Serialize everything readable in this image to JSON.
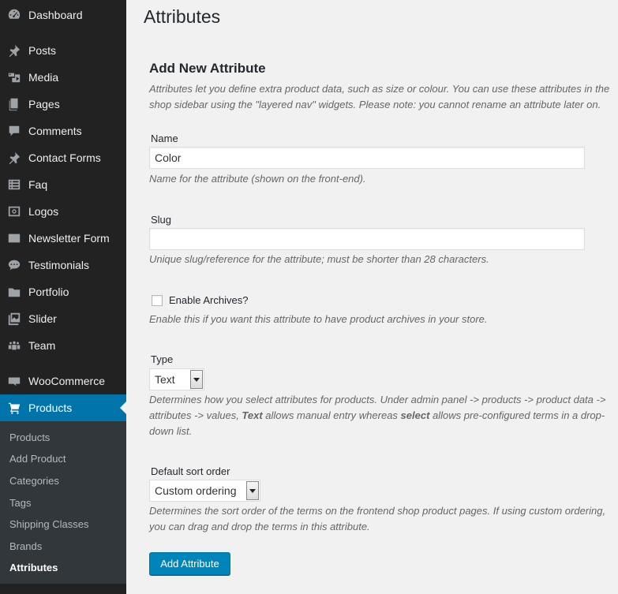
{
  "sidebar": {
    "items": [
      {
        "label": "Dashboard",
        "icon": "dashboard-icon"
      },
      {
        "label": "Posts",
        "icon": "pin-icon"
      },
      {
        "label": "Media",
        "icon": "media-icon"
      },
      {
        "label": "Pages",
        "icon": "pages-icon"
      },
      {
        "label": "Comments",
        "icon": "comment-icon"
      },
      {
        "label": "Contact Forms",
        "icon": "pin-icon"
      },
      {
        "label": "Faq",
        "icon": "list-icon"
      },
      {
        "label": "Logos",
        "icon": "camera-icon"
      },
      {
        "label": "Newsletter Form",
        "icon": "envelope-icon"
      },
      {
        "label": "Testimonials",
        "icon": "chat-icon"
      },
      {
        "label": "Portfolio",
        "icon": "folder-icon"
      },
      {
        "label": "Slider",
        "icon": "gallery-icon"
      },
      {
        "label": "Team",
        "icon": "groups-icon"
      },
      {
        "label": "WooCommerce",
        "icon": "woo-icon"
      },
      {
        "label": "Products",
        "icon": "cart-icon",
        "current": true
      }
    ],
    "submenu": [
      {
        "label": "Products"
      },
      {
        "label": "Add Product"
      },
      {
        "label": "Categories"
      },
      {
        "label": "Tags"
      },
      {
        "label": "Shipping Classes"
      },
      {
        "label": "Brands"
      },
      {
        "label": "Attributes",
        "active": true
      }
    ]
  },
  "page": {
    "title": "Attributes",
    "section_title": "Add New Attribute",
    "intro": "Attributes let you define extra product data, such as size or colour. You can use these attributes in the shop sidebar using the \"layered nav\" widgets. Please note: you cannot rename an attribute later on."
  },
  "form": {
    "name_label": "Name",
    "name_value": "Color",
    "name_desc": "Name for the attribute (shown on the front-end).",
    "slug_label": "Slug",
    "slug_value": "",
    "slug_desc": "Unique slug/reference for the attribute; must be shorter than 28 characters.",
    "archives_label": "Enable Archives?",
    "archives_checked": false,
    "archives_desc": "Enable this if you want this attribute to have product archives in your store.",
    "type_label": "Type",
    "type_value": "Text",
    "type_desc_1": "Determines how you select attributes for products. Under admin panel -> products -> product data -> attributes -> values, ",
    "type_desc_text": "Text",
    "type_desc_2": " allows manual entry whereas ",
    "type_desc_select": "select",
    "type_desc_3": " allows pre-configured terms in a drop-down list.",
    "sort_label": "Default sort order",
    "sort_value": "Custom ordering",
    "sort_desc": "Determines the sort order of the terms on the frontend shop product pages. If using custom ordering, you can drag and drop the terms in this attribute.",
    "submit_label": "Add Attribute"
  },
  "colors": {
    "sidebar_bg": "#222222",
    "submenu_bg": "#32373c",
    "accent": "#0073aa",
    "button": "#0085ba"
  }
}
